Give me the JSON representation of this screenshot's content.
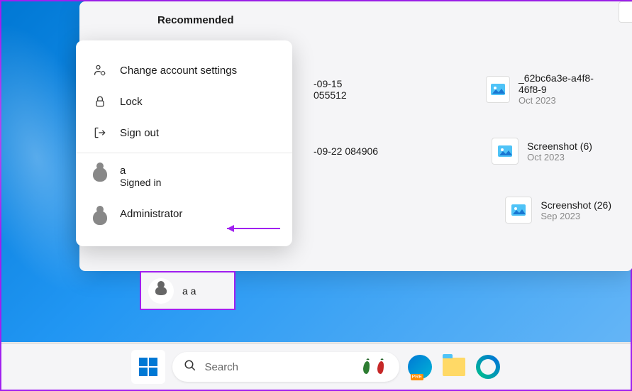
{
  "section_title": "Recommended",
  "user_menu": {
    "change_settings": "Change account settings",
    "lock": "Lock",
    "signout": "Sign out",
    "account_a_name": "a",
    "account_a_status": "Signed in",
    "account_admin": "Administrator"
  },
  "recommended": {
    "item1_name": "-09-15 055512",
    "item2_name": "_62bc6a3e-a4f8-46f8-9",
    "item2_date": "Oct 2023",
    "item3_name": "-09-22 084906",
    "item4_name": "Screenshot (6)",
    "item4_date": "Oct 2023",
    "item5_name": "Screenshot (26)",
    "item5_date": "Sep 2023"
  },
  "user_bar": {
    "name": "a a"
  },
  "taskbar": {
    "search_placeholder": "Search"
  }
}
